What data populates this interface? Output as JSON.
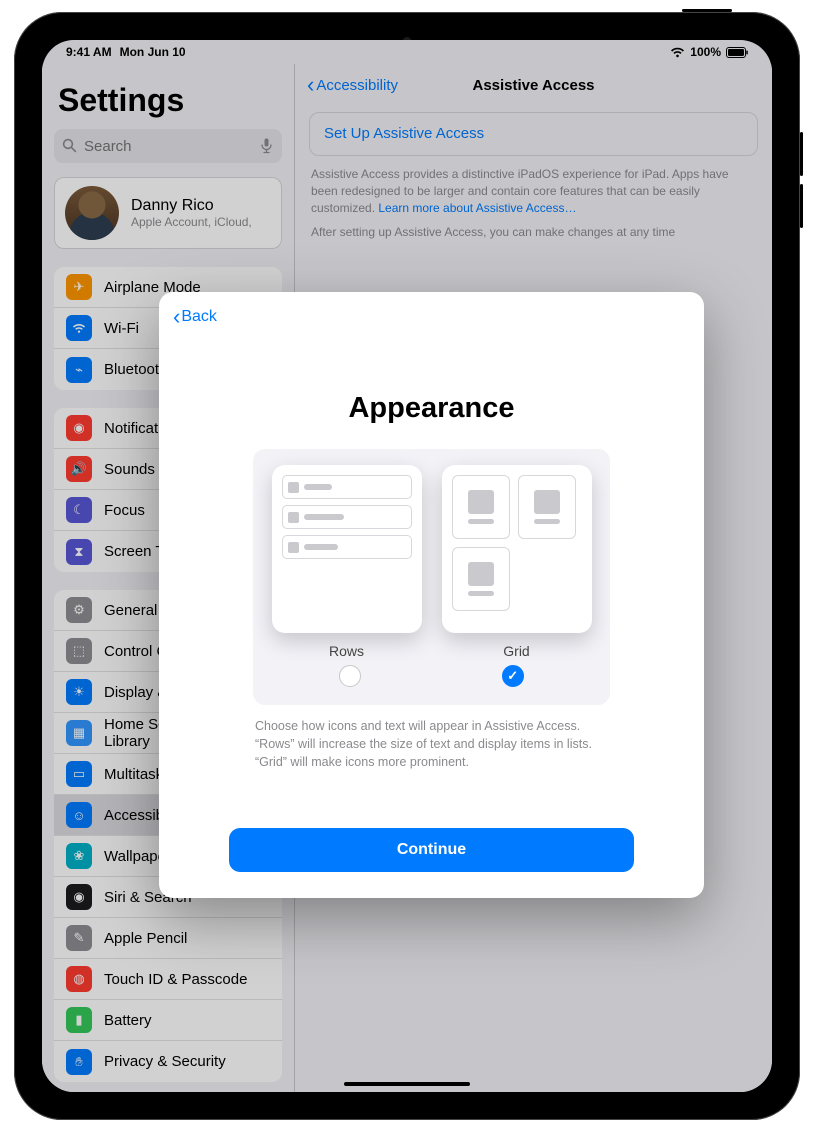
{
  "status": {
    "time": "9:41 AM",
    "date": "Mon Jun 10",
    "battery": "100%"
  },
  "sidebar": {
    "title": "Settings",
    "search_placeholder": "Search",
    "account": {
      "name": "Danny Rico",
      "subtitle": "Apple Account, iCloud,"
    },
    "groups": [
      {
        "items": [
          {
            "label": "Airplane Mode"
          },
          {
            "label": "Wi-Fi"
          },
          {
            "label": "Bluetooth"
          }
        ]
      },
      {
        "items": [
          {
            "label": "Notifications"
          },
          {
            "label": "Sounds"
          },
          {
            "label": "Focus"
          },
          {
            "label": "Screen Time"
          }
        ]
      },
      {
        "items": [
          {
            "label": "General"
          },
          {
            "label": "Control Center"
          },
          {
            "label": "Display & Brightness"
          },
          {
            "label": "Home Screen & App Library"
          },
          {
            "label": "Multitasking & Gestures"
          },
          {
            "label": "Accessibility",
            "selected": true
          },
          {
            "label": "Wallpaper"
          },
          {
            "label": "Siri & Search"
          },
          {
            "label": "Apple Pencil"
          },
          {
            "label": "Touch ID & Passcode"
          },
          {
            "label": "Battery"
          },
          {
            "label": "Privacy & Security"
          }
        ]
      }
    ]
  },
  "main": {
    "back_label": "Accessibility",
    "title": "Assistive Access",
    "setup_link": "Set Up Assistive Access",
    "info_line1": "Assistive Access provides a distinctive iPadOS experience for iPad. Apps have been redesigned to be larger and contain core features that can be easily customized. ",
    "learn_more": "Learn more about Assistive Access…",
    "info_line2": "After setting up Assistive Access, you can make changes at any time"
  },
  "modal": {
    "back": "Back",
    "title": "Appearance",
    "options": [
      {
        "label": "Rows",
        "selected": false
      },
      {
        "label": "Grid",
        "selected": true
      }
    ],
    "description": "Choose how icons and text will appear in Assistive Access. “Rows” will increase the size of text and display items in lists. “Grid” will make icons more prominent.",
    "continue": "Continue"
  }
}
